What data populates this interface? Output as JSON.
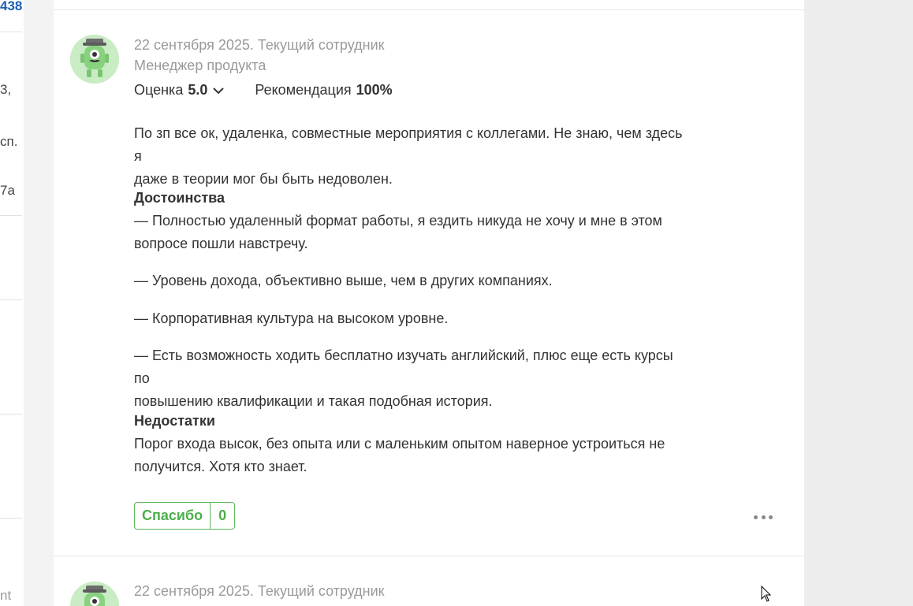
{
  "left_fragments": [
    "438",
    "3,",
    "сп.",
    "7а",
    "nt"
  ],
  "review1": {
    "date_status": "22 сентября 2025. Текущий сотрудник",
    "role": "Менеджер продукта",
    "rating_label": "Оценка",
    "rating_value": "5.0",
    "recommendation_label": "Рекомендация",
    "recommendation_value": "100%",
    "summary_line1": "По зп все ок, удаленка, совместные мероприятия с коллегами. Не знаю, чем здесь я",
    "summary_line2": "даже в теории мог бы быть недоволен.",
    "pros_title": "Достоинства",
    "pros_1_line1": "— Полностью удаленный формат работы, я ездить никуда не хочу и мне в этом",
    "pros_1_line2": "вопросе пошли навстречу.",
    "pros_2": "— Уровень дохода, объективно выше, чем в других компаниях.",
    "pros_3": "— Корпоративная культура на высоком уровне.",
    "pros_4_line1": "— Есть возможность ходить бесплатно изучать английский, плюс еще есть курсы по",
    "pros_4_line2": "повышению квалификации и такая подобная история.",
    "cons_title": "Недостатки",
    "cons_line1": "Порог входа высок, без опыта или с маленьким опытом наверное устроиться не",
    "cons_line2": "получится. Хотя кто знает.",
    "thanks_label": "Спасибо",
    "thanks_count": "0"
  },
  "review2": {
    "date_status": "22 сентября 2025. Текущий сотрудник"
  },
  "colors": {
    "accent_green": "#4cae4c",
    "link_blue": "#1a5fb4",
    "avatar_bg": "#c9ecc4"
  },
  "icons": [
    "robot-avatar-icon",
    "chevron-down-icon",
    "more-dots-icon",
    "mouse-cursor-icon"
  ]
}
